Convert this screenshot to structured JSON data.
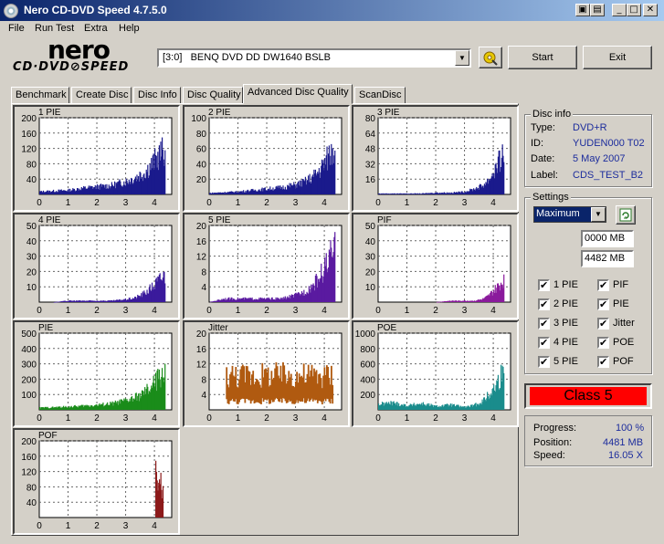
{
  "window": {
    "title": "Nero CD-DVD Speed 4.7.5.0",
    "minimize": "_",
    "maximize": "□",
    "close": "✕",
    "extra1": "▣",
    "extra2": "▤"
  },
  "menu": [
    "File",
    "Run Test",
    "Extra",
    "Help"
  ],
  "logo": {
    "nero": "nero",
    "cdspeed": "CD·DVD⊘SPEED"
  },
  "drive": {
    "value": "[3:0]   BENQ DVD DD DW1640 BSLB"
  },
  "buttons": {
    "start": "Start",
    "exit": "Exit"
  },
  "tabs": [
    "Benchmark",
    "Create Disc",
    "Disc Info",
    "Disc Quality",
    "Advanced Disc Quality",
    "ScanDisc"
  ],
  "active_tab": "Advanced Disc Quality",
  "disc_info": {
    "title": "Disc info",
    "rows": [
      {
        "label": "Type:",
        "value": "DVD+R"
      },
      {
        "label": "ID:",
        "value": "YUDEN000 T02"
      },
      {
        "label": "Date:",
        "value": "5 May 2007"
      },
      {
        "label": "Label:",
        "value": "CDS_TEST_B2"
      }
    ]
  },
  "settings": {
    "title": "Settings",
    "speed": "Maximum",
    "start_mb": "0000 MB",
    "end_mb": "4482 MB",
    "checkboxes": [
      {
        "label": "1 PIE",
        "checked": true
      },
      {
        "label": "PIF",
        "checked": true
      },
      {
        "label": "2 PIE",
        "checked": true
      },
      {
        "label": "PIE",
        "checked": true
      },
      {
        "label": "3 PIE",
        "checked": true
      },
      {
        "label": "Jitter",
        "checked": true
      },
      {
        "label": "4 PIE",
        "checked": true
      },
      {
        "label": "POE",
        "checked": true
      },
      {
        "label": "5 PIE",
        "checked": true
      },
      {
        "label": "POF",
        "checked": true
      }
    ],
    "check_mark": "✔"
  },
  "result": {
    "class": "Class 5"
  },
  "status": {
    "rows": [
      {
        "label": "Progress:",
        "value": "100 %"
      },
      {
        "label": "Position:",
        "value": "4481 MB"
      },
      {
        "label": "Speed:",
        "value": "16.05 X"
      }
    ]
  },
  "chart_data": [
    {
      "type": "bar",
      "title": "1 PIE",
      "color": "#1a1a8c",
      "ylim": [
        0,
        200
      ],
      "yticks": [
        "200",
        "160",
        "120",
        "80",
        "40"
      ],
      "xticks": [
        "0",
        "1",
        "2",
        "3",
        "4"
      ],
      "x": [
        0.0,
        0.5,
        1.0,
        1.5,
        2.0,
        2.5,
        3.0,
        3.3,
        3.6,
        3.8,
        4.0,
        4.2,
        4.35
      ],
      "values": [
        8,
        10,
        12,
        18,
        22,
        26,
        38,
        48,
        62,
        78,
        98,
        118,
        130
      ]
    },
    {
      "type": "bar",
      "title": "2 PIE",
      "color": "#1a1a8c",
      "ylim": [
        0,
        100
      ],
      "yticks": [
        "100",
        "80",
        "60",
        "40",
        "20"
      ],
      "xticks": [
        "0",
        "1",
        "2",
        "3",
        "4"
      ],
      "x": [
        0.0,
        0.5,
        1.0,
        1.5,
        2.0,
        2.5,
        3.0,
        3.3,
        3.6,
        3.8,
        4.0,
        4.2,
        4.35
      ],
      "values": [
        2,
        3,
        4,
        6,
        8,
        10,
        14,
        18,
        26,
        34,
        46,
        60,
        72
      ]
    },
    {
      "type": "bar",
      "title": "3 PIE",
      "color": "#1a1a8c",
      "ylim": [
        0,
        80
      ],
      "yticks": [
        "80",
        "64",
        "48",
        "32",
        "16"
      ],
      "xticks": [
        "0",
        "1",
        "2",
        "3",
        "4"
      ],
      "x": [
        0.0,
        0.5,
        1.0,
        1.5,
        2.0,
        2.5,
        3.0,
        3.3,
        3.6,
        3.8,
        4.0,
        4.2,
        4.35
      ],
      "values": [
        1,
        1,
        1,
        1,
        2,
        2,
        3,
        6,
        10,
        16,
        26,
        38,
        48
      ]
    },
    {
      "type": "bar",
      "title": "4 PIE",
      "color": "#3a1a9c",
      "ylim": [
        0,
        50
      ],
      "yticks": [
        "50",
        "40",
        "30",
        "20",
        "10"
      ],
      "xticks": [
        "0",
        "1",
        "2",
        "3",
        "4"
      ],
      "x": [
        0.0,
        0.5,
        1.0,
        1.5,
        2.0,
        2.5,
        3.0,
        3.3,
        3.6,
        3.8,
        4.0,
        4.2,
        4.35
      ],
      "values": [
        0,
        0,
        1,
        1,
        1,
        1,
        2,
        3,
        6,
        9,
        13,
        17,
        20
      ]
    },
    {
      "type": "bar",
      "title": "5 PIE",
      "color": "#5a1aa0",
      "ylim": [
        0,
        20
      ],
      "yticks": [
        "20",
        "16",
        "12",
        "8",
        "4"
      ],
      "xticks": [
        "0",
        "1",
        "2",
        "3",
        "4"
      ],
      "x": [
        0.0,
        0.5,
        1.0,
        1.5,
        2.0,
        2.5,
        3.0,
        3.3,
        3.6,
        3.8,
        4.0,
        4.2,
        4.35
      ],
      "values": [
        0,
        1,
        1,
        1,
        1,
        1,
        2,
        3,
        5,
        7,
        10,
        13,
        15
      ]
    },
    {
      "type": "bar",
      "title": "PIF",
      "color": "#8a1a9c",
      "ylim": [
        0,
        50
      ],
      "yticks": [
        "50",
        "40",
        "30",
        "20",
        "10"
      ],
      "xticks": [
        "0",
        "1",
        "2",
        "3",
        "4"
      ],
      "x": [
        0.0,
        0.5,
        1.0,
        1.5,
        2.0,
        2.5,
        3.0,
        3.3,
        3.6,
        3.8,
        4.0,
        4.2,
        4.35
      ],
      "values": [
        0,
        0,
        0,
        0,
        0,
        1,
        1,
        1,
        2,
        4,
        8,
        12,
        16
      ]
    },
    {
      "type": "area",
      "title": "PIE",
      "color": "#1a8c1a",
      "ylim": [
        0,
        500
      ],
      "yticks": [
        "500",
        "400",
        "300",
        "200",
        "100"
      ],
      "xticks": [
        "0",
        "1",
        "2",
        "3",
        "4"
      ],
      "x": [
        0.0,
        0.5,
        1.0,
        1.5,
        2.0,
        2.5,
        3.0,
        3.3,
        3.6,
        3.8,
        4.0,
        4.2,
        4.35
      ],
      "values": [
        15,
        18,
        22,
        28,
        35,
        45,
        65,
        85,
        115,
        150,
        195,
        250,
        290
      ]
    },
    {
      "type": "bar",
      "title": "Jitter",
      "color": "#b05a10",
      "ylim": [
        0,
        20
      ],
      "yticks": [
        "20",
        "16",
        "12",
        "8",
        "4"
      ],
      "xticks": [
        "0",
        "1",
        "2",
        "3",
        "4"
      ],
      "x": [
        0.6,
        1.0,
        1.5,
        2.0,
        2.5,
        3.0,
        3.5,
        4.0,
        4.3
      ],
      "values": [
        10,
        10,
        10,
        10,
        10,
        10,
        10,
        10,
        10
      ]
    },
    {
      "type": "bar",
      "title": "POE",
      "color": "#1a8c8c",
      "ylim": [
        0,
        1000
      ],
      "yticks": [
        "1000",
        "800",
        "600",
        "400",
        "200"
      ],
      "xticks": [
        "0",
        "1",
        "2",
        "3",
        "4"
      ],
      "x": [
        0.0,
        0.5,
        1.0,
        1.5,
        2.0,
        2.5,
        3.0,
        3.3,
        3.6,
        3.8,
        4.0,
        4.2,
        4.35
      ],
      "values": [
        80,
        100,
        60,
        90,
        50,
        70,
        40,
        60,
        120,
        200,
        300,
        450,
        560
      ]
    },
    {
      "type": "bar",
      "title": "POF",
      "color": "#8c1a1a",
      "ylim": [
        0,
        200
      ],
      "yticks": [
        "200",
        "160",
        "120",
        "80",
        "40"
      ],
      "xticks": [
        "0",
        "1",
        "2",
        "3",
        "4"
      ],
      "x": [
        4.05,
        4.1,
        4.15,
        4.2,
        4.25,
        4.3
      ],
      "values": [
        160,
        90,
        160,
        120,
        40,
        160
      ]
    }
  ]
}
